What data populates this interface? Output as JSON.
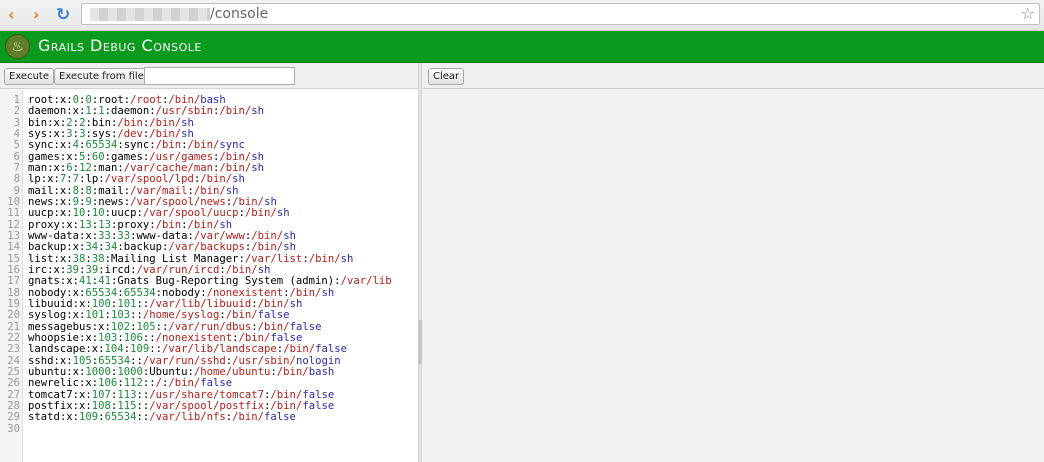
{
  "browser": {
    "back_icon": "‹",
    "forward_icon": "›",
    "reload_icon": "↻",
    "url_path": "/console",
    "star_icon": "☆"
  },
  "app": {
    "title": "Grails Debug Console",
    "logo_icon": "♨"
  },
  "toolbar": {
    "execute_label": "Execute",
    "execute_file_label": "Execute from file:",
    "file_value": "",
    "clear_label": "Clear"
  },
  "editor": {
    "lines": [
      "root:x:0:0:root:/root:/bin/bash",
      "daemon:x:1:1:daemon:/usr/sbin:/bin/sh",
      "bin:x:2:2:bin:/bin:/bin/sh",
      "sys:x:3:3:sys:/dev:/bin/sh",
      "sync:x:4:65534:sync:/bin:/bin/sync",
      "games:x:5:60:games:/usr/games:/bin/sh",
      "man:x:6:12:man:/var/cache/man:/bin/sh",
      "lp:x:7:7:lp:/var/spool/lpd:/bin/sh",
      "mail:x:8:8:mail:/var/mail:/bin/sh",
      "news:x:9:9:news:/var/spool/news:/bin/sh",
      "uucp:x:10:10:uucp:/var/spool/uucp:/bin/sh",
      "proxy:x:13:13:proxy:/bin:/bin/sh",
      "www-data:x:33:33:www-data:/var/www:/bin/sh",
      "backup:x:34:34:backup:/var/backups:/bin/sh",
      "list:x:38:38:Mailing List Manager:/var/list:/bin/sh",
      "irc:x:39:39:ircd:/var/run/ircd:/bin/sh",
      "gnats:x:41:41:Gnats Bug-Reporting System (admin):/var/lib",
      "nobody:x:65534:65534:nobody:/nonexistent:/bin/sh",
      "libuuid:x:100:101::/var/lib/libuuid:/bin/sh",
      "syslog:x:101:103::/home/syslog:/bin/false",
      "messagebus:x:102:105::/var/run/dbus:/bin/false",
      "whoopsie:x:103:106::/nonexistent:/bin/false",
      "landscape:x:104:109::/var/lib/landscape:/bin/false",
      "sshd:x:105:65534::/var/run/sshd:/usr/sbin/nologin",
      "ubuntu:x:1000:1000:Ubuntu:/home/ubuntu:/bin/bash",
      "newrelic:x:106:112::/:/bin/false",
      "tomcat7:x:107:113::/usr/share/tomcat7:/bin/false",
      "postfix:x:108:115::/var/spool/postfix:/bin/false",
      "statd:x:109:65534::/var/lib/nfs:/bin/false",
      ""
    ]
  },
  "colors": {
    "header_green": "#0a9a1e",
    "number_green": "#1c8a3c",
    "path_red": "#b2201c",
    "keyword_blue": "#2a2aa6"
  }
}
